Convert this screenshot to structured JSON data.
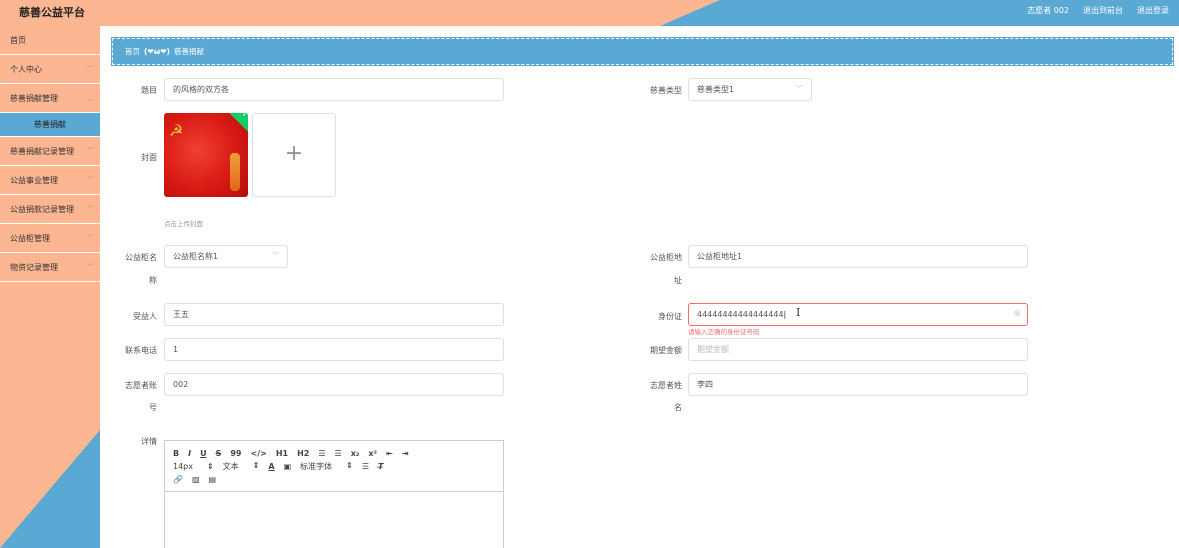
{
  "header": {
    "title": "慈善公益平台",
    "user": "志愿者 002",
    "back_front": "退出到前台",
    "logout": "退出登录"
  },
  "sidebar": {
    "items": [
      {
        "label": "首页",
        "has_chevron": false
      },
      {
        "label": "个人中心",
        "has_chevron": true
      },
      {
        "label": "慈善捐献管理",
        "has_chevron": true
      },
      {
        "label": "慈善捐献",
        "sub": true
      },
      {
        "label": "慈善捐献记录管理",
        "has_chevron": true
      },
      {
        "label": "公益事业管理",
        "has_chevron": true
      },
      {
        "label": "公益捐款记录管理",
        "has_chevron": true
      },
      {
        "label": "公益柜管理",
        "has_chevron": true
      },
      {
        "label": "物资记录管理",
        "has_chevron": true
      }
    ]
  },
  "breadcrumb": {
    "home": "首页",
    "face": "(❤ω❤)",
    "current": "慈善捐献"
  },
  "form": {
    "title_label": "题目",
    "title_value": "的风格的双方各",
    "type_label": "慈善类型",
    "type_value": "慈善类型1",
    "cover_label": "封面",
    "cover_tip": "点击上传封面",
    "cabinet_name_label_1": "公益柜名",
    "cabinet_name_label_2": "称",
    "cabinet_name_value": "公益柜名称1",
    "cabinet_addr_label_1": "公益柜地",
    "cabinet_addr_label_2": "址",
    "cabinet_addr_value": "公益柜地址1",
    "beneficiary_label": "受益人",
    "beneficiary_value": "王五",
    "idcard_label": "身份证",
    "idcard_value": "44444444444444444",
    "idcard_error": "请输入正确的身份证号码",
    "phone_label": "联系电话",
    "phone_value": "1",
    "amount_label": "期望金额",
    "amount_placeholder": "期望金额",
    "vol_account_label_1": "志愿者账",
    "vol_account_label_2": "号",
    "vol_account_value": "002",
    "vol_name_label_1": "志愿者姓",
    "vol_name_label_2": "名",
    "vol_name_value": "李四",
    "detail_label": "详情"
  },
  "editor": {
    "row1": [
      "B",
      "I",
      "U",
      "S",
      "99",
      "</>",
      "H1",
      "H2",
      "☰",
      "☰",
      "x₂",
      "x²",
      "⇤",
      "⇥"
    ],
    "font_size": "14px",
    "text_type": "文本",
    "font_family": "标准字体"
  },
  "colors": {
    "peach": "#fdb692",
    "blue": "#5aa8d4",
    "error": "#f56c6c"
  }
}
